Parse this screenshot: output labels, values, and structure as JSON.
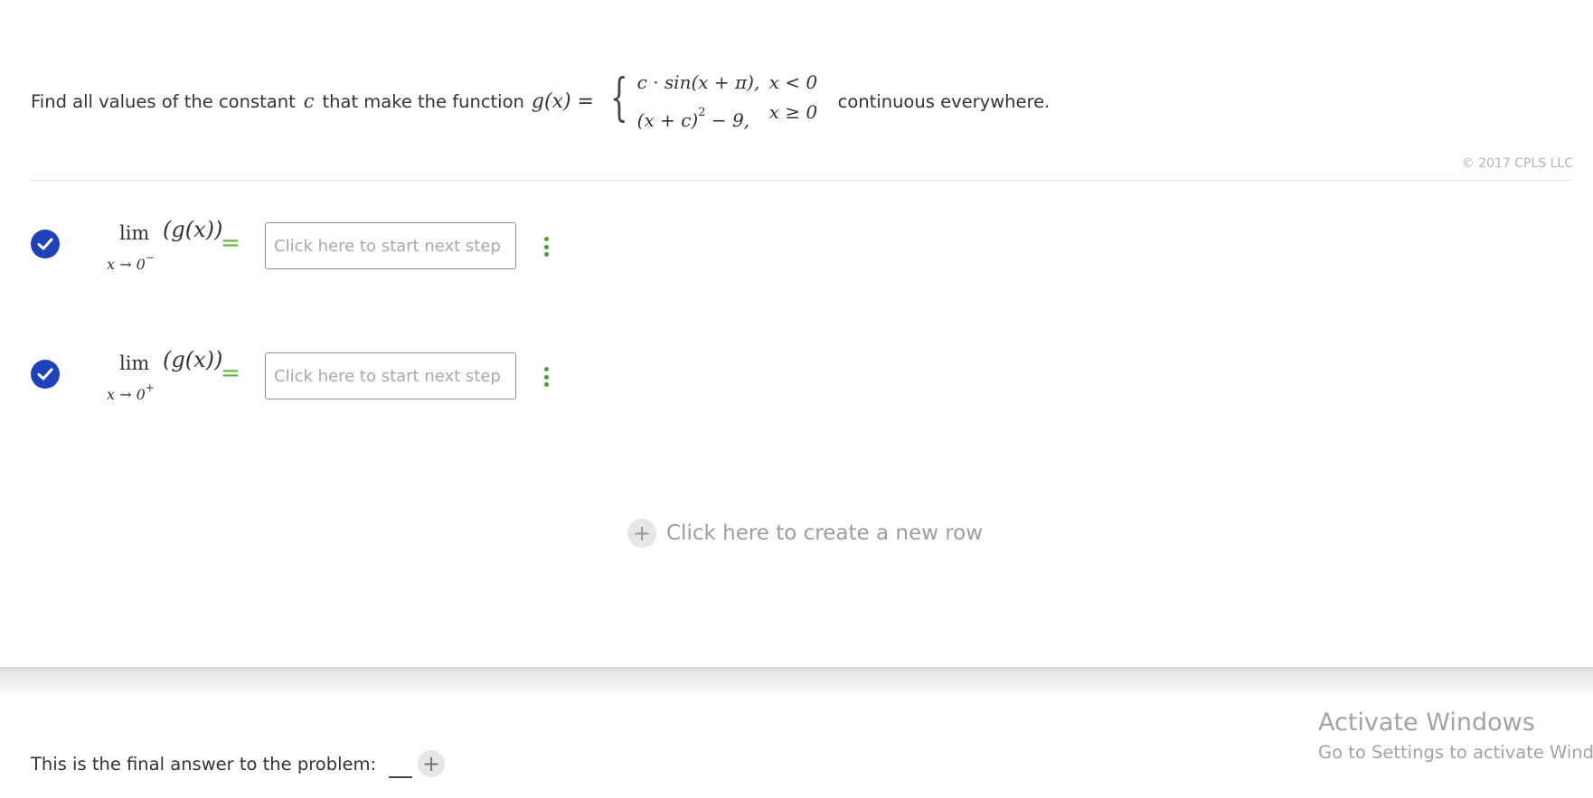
{
  "problem": {
    "prefix": "Find all values of the constant",
    "constant": "c",
    "middle": "that make the function",
    "function_lhs": "g(x) =",
    "cases": [
      {
        "expr": "c · sin(x + π),",
        "cond": "x < 0"
      },
      {
        "expr_base": "(x + c)",
        "expr_exp": "2",
        "expr_tail": " − 9,",
        "cond": "x ≥ 0"
      }
    ],
    "suffix": "continuous everywhere."
  },
  "copyright": "© 2017 CPLS LLC",
  "steps": [
    {
      "lim": "lim",
      "sub_var": "x → 0",
      "sub_sign": "−",
      "argument": "(g(x))",
      "equals": "=",
      "placeholder": "Click here to start next step"
    },
    {
      "lim": "lim",
      "sub_var": "x → 0",
      "sub_sign": "+",
      "argument": "(g(x))",
      "equals": "=",
      "placeholder": "Click here to start next step"
    }
  ],
  "new_row": {
    "icon": "+",
    "label": "Click here to create a new row"
  },
  "final_answer": {
    "label": "This is the final answer to the problem:",
    "add_icon": "+"
  },
  "watermark": {
    "title": "Activate Windows",
    "subtitle": "Go to Settings to activate Windows."
  },
  "colors": {
    "check": "#2042b8",
    "accent_green": "#62b33d",
    "text": "#333333",
    "muted": "#a9a9a9"
  }
}
